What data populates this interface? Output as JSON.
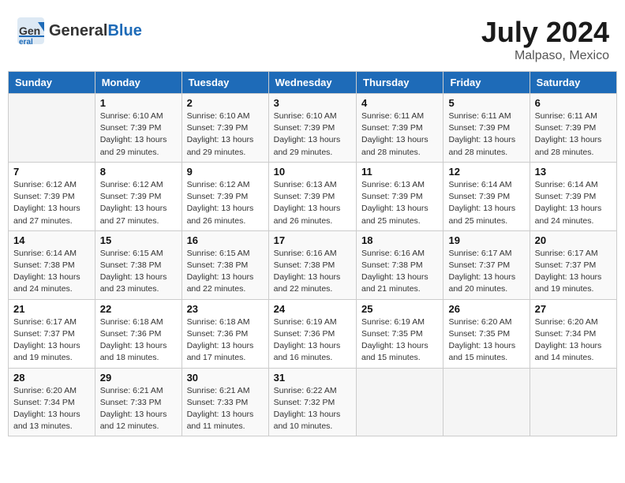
{
  "header": {
    "logo": {
      "general": "General",
      "blue": "Blue"
    },
    "title": "July 2024",
    "location": "Malpaso, Mexico"
  },
  "days": [
    "Sunday",
    "Monday",
    "Tuesday",
    "Wednesday",
    "Thursday",
    "Friday",
    "Saturday"
  ],
  "weeks": [
    [
      {
        "day": "",
        "sunrise": "",
        "sunset": "",
        "daylight": ""
      },
      {
        "day": "1",
        "sunrise": "Sunrise: 6:10 AM",
        "sunset": "Sunset: 7:39 PM",
        "daylight": "Daylight: 13 hours and 29 minutes."
      },
      {
        "day": "2",
        "sunrise": "Sunrise: 6:10 AM",
        "sunset": "Sunset: 7:39 PM",
        "daylight": "Daylight: 13 hours and 29 minutes."
      },
      {
        "day": "3",
        "sunrise": "Sunrise: 6:10 AM",
        "sunset": "Sunset: 7:39 PM",
        "daylight": "Daylight: 13 hours and 29 minutes."
      },
      {
        "day": "4",
        "sunrise": "Sunrise: 6:11 AM",
        "sunset": "Sunset: 7:39 PM",
        "daylight": "Daylight: 13 hours and 28 minutes."
      },
      {
        "day": "5",
        "sunrise": "Sunrise: 6:11 AM",
        "sunset": "Sunset: 7:39 PM",
        "daylight": "Daylight: 13 hours and 28 minutes."
      },
      {
        "day": "6",
        "sunrise": "Sunrise: 6:11 AM",
        "sunset": "Sunset: 7:39 PM",
        "daylight": "Daylight: 13 hours and 28 minutes."
      }
    ],
    [
      {
        "day": "7",
        "sunrise": "Sunrise: 6:12 AM",
        "sunset": "Sunset: 7:39 PM",
        "daylight": "Daylight: 13 hours and 27 minutes."
      },
      {
        "day": "8",
        "sunrise": "Sunrise: 6:12 AM",
        "sunset": "Sunset: 7:39 PM",
        "daylight": "Daylight: 13 hours and 27 minutes."
      },
      {
        "day": "9",
        "sunrise": "Sunrise: 6:12 AM",
        "sunset": "Sunset: 7:39 PM",
        "daylight": "Daylight: 13 hours and 26 minutes."
      },
      {
        "day": "10",
        "sunrise": "Sunrise: 6:13 AM",
        "sunset": "Sunset: 7:39 PM",
        "daylight": "Daylight: 13 hours and 26 minutes."
      },
      {
        "day": "11",
        "sunrise": "Sunrise: 6:13 AM",
        "sunset": "Sunset: 7:39 PM",
        "daylight": "Daylight: 13 hours and 25 minutes."
      },
      {
        "day": "12",
        "sunrise": "Sunrise: 6:14 AM",
        "sunset": "Sunset: 7:39 PM",
        "daylight": "Daylight: 13 hours and 25 minutes."
      },
      {
        "day": "13",
        "sunrise": "Sunrise: 6:14 AM",
        "sunset": "Sunset: 7:39 PM",
        "daylight": "Daylight: 13 hours and 24 minutes."
      }
    ],
    [
      {
        "day": "14",
        "sunrise": "Sunrise: 6:14 AM",
        "sunset": "Sunset: 7:38 PM",
        "daylight": "Daylight: 13 hours and 24 minutes."
      },
      {
        "day": "15",
        "sunrise": "Sunrise: 6:15 AM",
        "sunset": "Sunset: 7:38 PM",
        "daylight": "Daylight: 13 hours and 23 minutes."
      },
      {
        "day": "16",
        "sunrise": "Sunrise: 6:15 AM",
        "sunset": "Sunset: 7:38 PM",
        "daylight": "Daylight: 13 hours and 22 minutes."
      },
      {
        "day": "17",
        "sunrise": "Sunrise: 6:16 AM",
        "sunset": "Sunset: 7:38 PM",
        "daylight": "Daylight: 13 hours and 22 minutes."
      },
      {
        "day": "18",
        "sunrise": "Sunrise: 6:16 AM",
        "sunset": "Sunset: 7:38 PM",
        "daylight": "Daylight: 13 hours and 21 minutes."
      },
      {
        "day": "19",
        "sunrise": "Sunrise: 6:17 AM",
        "sunset": "Sunset: 7:37 PM",
        "daylight": "Daylight: 13 hours and 20 minutes."
      },
      {
        "day": "20",
        "sunrise": "Sunrise: 6:17 AM",
        "sunset": "Sunset: 7:37 PM",
        "daylight": "Daylight: 13 hours and 19 minutes."
      }
    ],
    [
      {
        "day": "21",
        "sunrise": "Sunrise: 6:17 AM",
        "sunset": "Sunset: 7:37 PM",
        "daylight": "Daylight: 13 hours and 19 minutes."
      },
      {
        "day": "22",
        "sunrise": "Sunrise: 6:18 AM",
        "sunset": "Sunset: 7:36 PM",
        "daylight": "Daylight: 13 hours and 18 minutes."
      },
      {
        "day": "23",
        "sunrise": "Sunrise: 6:18 AM",
        "sunset": "Sunset: 7:36 PM",
        "daylight": "Daylight: 13 hours and 17 minutes."
      },
      {
        "day": "24",
        "sunrise": "Sunrise: 6:19 AM",
        "sunset": "Sunset: 7:36 PM",
        "daylight": "Daylight: 13 hours and 16 minutes."
      },
      {
        "day": "25",
        "sunrise": "Sunrise: 6:19 AM",
        "sunset": "Sunset: 7:35 PM",
        "daylight": "Daylight: 13 hours and 15 minutes."
      },
      {
        "day": "26",
        "sunrise": "Sunrise: 6:20 AM",
        "sunset": "Sunset: 7:35 PM",
        "daylight": "Daylight: 13 hours and 15 minutes."
      },
      {
        "day": "27",
        "sunrise": "Sunrise: 6:20 AM",
        "sunset": "Sunset: 7:34 PM",
        "daylight": "Daylight: 13 hours and 14 minutes."
      }
    ],
    [
      {
        "day": "28",
        "sunrise": "Sunrise: 6:20 AM",
        "sunset": "Sunset: 7:34 PM",
        "daylight": "Daylight: 13 hours and 13 minutes."
      },
      {
        "day": "29",
        "sunrise": "Sunrise: 6:21 AM",
        "sunset": "Sunset: 7:33 PM",
        "daylight": "Daylight: 13 hours and 12 minutes."
      },
      {
        "day": "30",
        "sunrise": "Sunrise: 6:21 AM",
        "sunset": "Sunset: 7:33 PM",
        "daylight": "Daylight: 13 hours and 11 minutes."
      },
      {
        "day": "31",
        "sunrise": "Sunrise: 6:22 AM",
        "sunset": "Sunset: 7:32 PM",
        "daylight": "Daylight: 13 hours and 10 minutes."
      },
      {
        "day": "",
        "sunrise": "",
        "sunset": "",
        "daylight": ""
      },
      {
        "day": "",
        "sunrise": "",
        "sunset": "",
        "daylight": ""
      },
      {
        "day": "",
        "sunrise": "",
        "sunset": "",
        "daylight": ""
      }
    ]
  ]
}
